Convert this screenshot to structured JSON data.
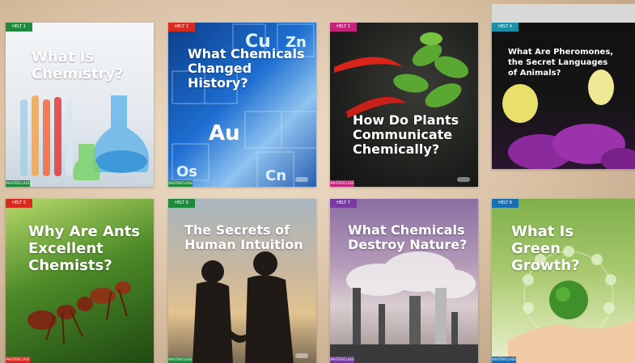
{
  "cards": [
    {
      "tag": "HELT 1",
      "title": "What Is\nChemistry?",
      "footer": "MASTERCLASS",
      "tag_color": "#1f8a3c",
      "theme": "lab glassware"
    },
    {
      "tag": "HELT 2",
      "title": "What Chemicals\nChanged History?",
      "footer": "MASTERCLASS",
      "tag_color": "#d42b1e",
      "theme": "periodic table"
    },
    {
      "tag": "HELT 3",
      "title": "How Do Plants\nCommunicate\nChemically?",
      "footer": "MASTERCLASS",
      "tag_color": "#c3237a",
      "theme": "plant and chili"
    },
    {
      "tag": "HELT 4",
      "title": "What Are Pheromones,\nthe Secret Languages\nof Animals?",
      "footer": "MASTERCLASS",
      "tag_color": "#1a8fa5",
      "theme": "butterflies on flowers"
    },
    {
      "tag": "HELT 5",
      "title": "Why Are Ants\nExcellent\nChemists?",
      "footer": "MASTERCLASS",
      "tag_color": "#d42b1e",
      "theme": "ants"
    },
    {
      "tag": "HELT 6",
      "title": "The Secrets of\nHuman Intuition",
      "footer": "MASTERCLASS",
      "tag_color": "#1f8a3c",
      "theme": "couple holding hands"
    },
    {
      "tag": "HELT 7",
      "title": "What Chemicals\nDestroy Nature?",
      "footer": "MASTERCLASS",
      "tag_color": "#7a3aa3",
      "theme": "factory smoke"
    },
    {
      "tag": "HELT 8",
      "title": "What Is Green\nGrowth?",
      "footer": "MASTERCLASS",
      "tag_color": "#1a6fb0",
      "theme": "globe in hand"
    }
  ]
}
